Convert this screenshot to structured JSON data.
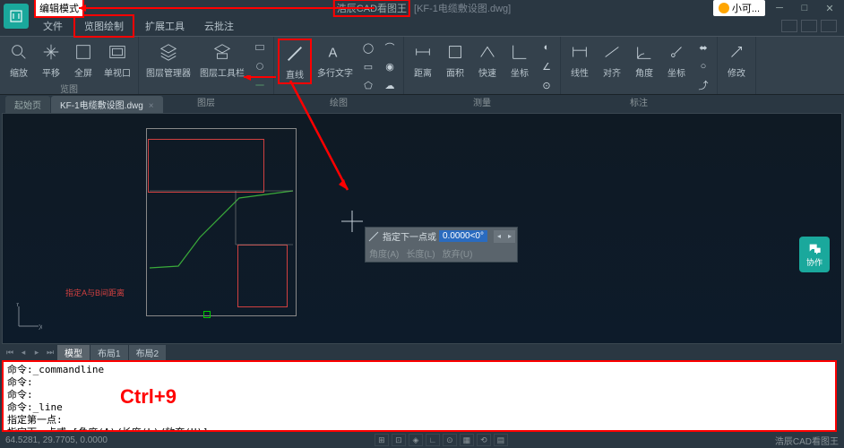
{
  "titlebar": {
    "edit_mode": "编辑模式",
    "app_name": "浩辰CAD看图王",
    "file_label": "[KF-1电缆敷设图.dwg]",
    "small_badge": "小可..."
  },
  "menu": {
    "file": "文件",
    "view_draw": "览图绘制",
    "ext_tools": "扩展工具",
    "cloud": "云批注"
  },
  "ribbon": {
    "group_view": "览图",
    "group_layer": "图层",
    "group_draw": "绘图",
    "group_measure": "测量",
    "group_annotate": "标注",
    "zoom": "缩放",
    "pan": "平移",
    "fullscreen": "全屏",
    "viewport": "单视口",
    "layer_mgr": "图层管理器",
    "layer_tools": "图层工具栏",
    "line": "直线",
    "mtext": "多行文字",
    "dist": "距离",
    "area": "面积",
    "quick": "快速",
    "coord": "坐标",
    "linear": "线性",
    "align": "对齐",
    "angle": "角度",
    "coord2": "坐标",
    "modify": "修改"
  },
  "tabs": {
    "start": "起始页",
    "file": "KF-1电缆敷设图.dwg"
  },
  "canvas": {
    "red_label": "指定A与B间距离"
  },
  "input": {
    "prompt": "指定下一点或",
    "value": "0.0000<0°",
    "opt1": "角度(A)",
    "opt2": "长度(L)",
    "opt3": "放弃(U)"
  },
  "chat": {
    "label": "协作"
  },
  "layout": {
    "model": "模型",
    "l1": "布局1",
    "l2": "布局2"
  },
  "command": {
    "l1": "命令:_commandline",
    "l2": "命令:",
    "l3": "命令:",
    "l4": "命令:_line",
    "l5": "指定第一点:",
    "l6": "指定下一点或 [角度(A)/长度(L)/放弃(U)]:",
    "annotation": "Ctrl+9"
  },
  "status": {
    "coords": "64.5281, 29.7705, 0.0000",
    "brand": "浩辰CAD看图王"
  }
}
